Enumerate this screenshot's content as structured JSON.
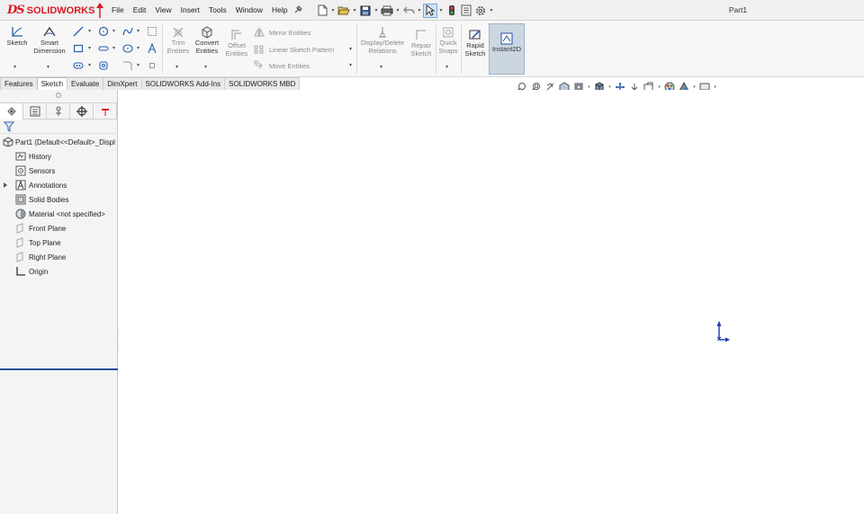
{
  "app": {
    "logo_ds": "DS",
    "logo_text": "SOLIDWORKS",
    "document_title": "Part1",
    "accent_color": "#d51c24",
    "selection_color": "#2a4f9c"
  },
  "menu": {
    "items": [
      {
        "label": "File"
      },
      {
        "label": "Edit"
      },
      {
        "label": "View"
      },
      {
        "label": "Insert"
      },
      {
        "label": "Tools"
      },
      {
        "label": "Window"
      },
      {
        "label": "Help"
      }
    ]
  },
  "quick_access": {
    "icons": [
      "new-document-icon",
      "open-icon",
      "save-icon",
      "print-icon",
      "undo-icon",
      "select-icon",
      "rebuild-icon",
      "file-properties-icon",
      "options-icon"
    ]
  },
  "ribbon": {
    "sketch": "Sketch",
    "smart_dimension_1": "Smart",
    "smart_dimension_2": "Dimension",
    "trim_1": "Trim",
    "trim_2": "Entities",
    "convert_1": "Convert",
    "convert_2": "Entities",
    "offset_1": "Offset",
    "offset_2": "Entities",
    "mirror": "Mirror Entities",
    "linear_pattern": "Linear Sketch Pattern",
    "move": "Move Entities",
    "display_delete_1": "Display/Delete",
    "display_delete_2": "Relations",
    "repair_1": "Repair",
    "repair_2": "Sketch",
    "quick_snaps_1": "Quick",
    "quick_snaps_2": "Snaps",
    "rapid_1": "Rapid",
    "rapid_2": "Sketch",
    "instant2d": "Instant2D"
  },
  "tabs": [
    {
      "label": "Features"
    },
    {
      "label": "Sketch"
    },
    {
      "label": "Evaluate"
    },
    {
      "label": "DimXpert"
    },
    {
      "label": "SOLIDWORKS Add-Ins"
    },
    {
      "label": "SOLIDWORKS MBD"
    }
  ],
  "active_tab": "Sketch",
  "feature_tree": {
    "root": "Part1  (Default<<Default>_Displ",
    "items": [
      {
        "label": "History",
        "icon": "history-icon"
      },
      {
        "label": "Sensors",
        "icon": "sensors-icon"
      },
      {
        "label": "Annotations",
        "icon": "annotations-icon"
      },
      {
        "label": "Solid Bodies",
        "icon": "solid-bodies-icon"
      },
      {
        "label": "Material <not specified>",
        "icon": "material-icon"
      },
      {
        "label": "Front Plane",
        "icon": "plane-icon"
      },
      {
        "label": "Top Plane",
        "icon": "plane-icon"
      },
      {
        "label": "Right Plane",
        "icon": "plane-icon"
      },
      {
        "label": "Origin",
        "icon": "origin-icon"
      }
    ]
  }
}
